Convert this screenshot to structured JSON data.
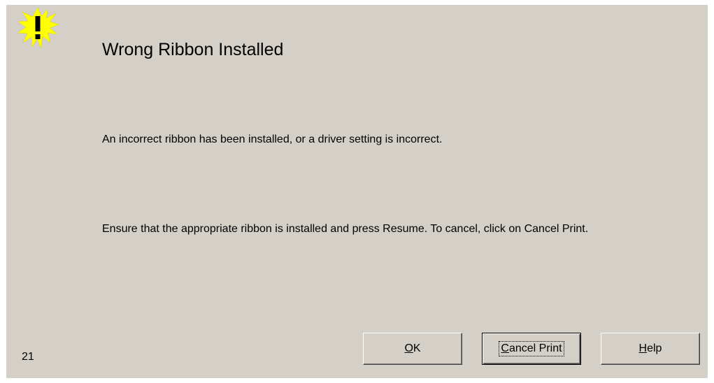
{
  "dialog": {
    "title": "Wrong Ribbon Installed",
    "message_line1": "An incorrect ribbon has been installed, or a driver setting is incorrect.",
    "message_line2": "Ensure that the appropriate ribbon is installed and press Resume. To cancel, click on Cancel Print.",
    "error_code": "21",
    "icon": "warning-exclamation-icon",
    "background_color": "#d4d0c8",
    "icon_color": "#ffff00"
  },
  "buttons": {
    "ok": {
      "mnemonic": "O",
      "rest": "K"
    },
    "cancel_print": {
      "mnemonic": "C",
      "rest": "ancel Print"
    },
    "help": {
      "mnemonic": "H",
      "rest": "elp"
    }
  }
}
